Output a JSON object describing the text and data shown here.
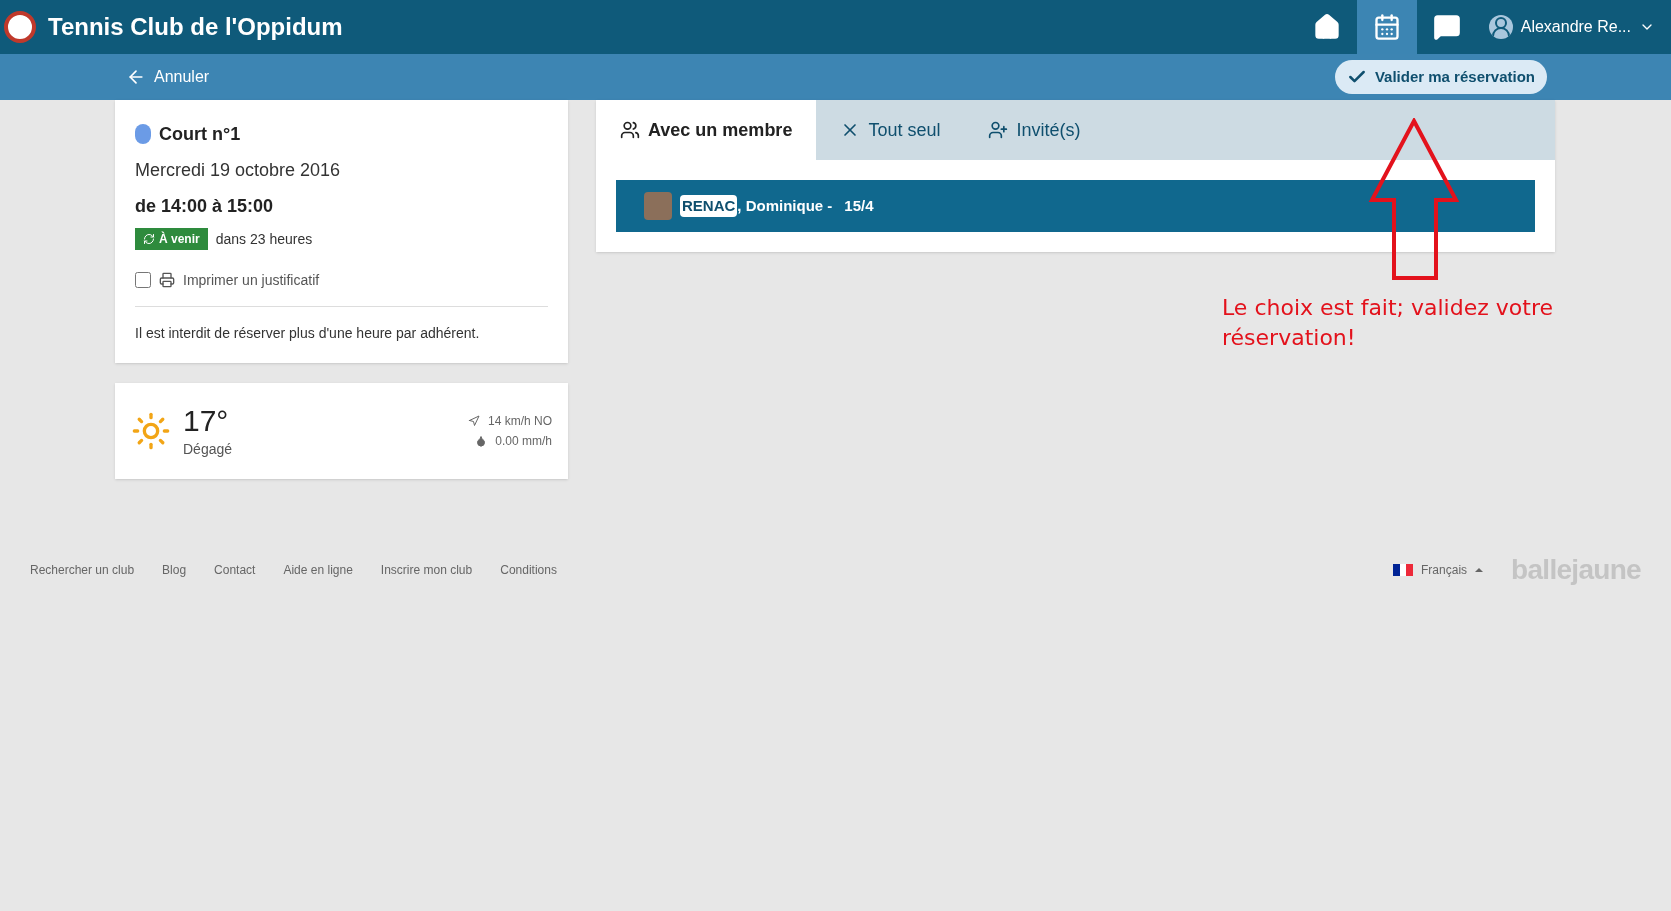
{
  "header": {
    "title": "Tennis Club de l'Oppidum",
    "nav": [
      {
        "kind": "home",
        "selected": false
      },
      {
        "kind": "calendar",
        "selected": true
      },
      {
        "kind": "chat",
        "selected": false
      }
    ],
    "user": "Alexandre Re..."
  },
  "toolbar": {
    "cancel": "Annuler",
    "validate": "Valider ma réservation"
  },
  "booking": {
    "court": {
      "name": "Court n°1",
      "color": "#6b9be6"
    },
    "date": "Mercredi 19 octobre 2016",
    "time": "de 14:00 à 15:00",
    "badge": "À venir",
    "countdown": "dans 23 heures",
    "print": {
      "label": "Imprimer un justificatif",
      "checked": false
    },
    "rule": "Il est interdit de réserver plus d'une heure par adhérent."
  },
  "weather": {
    "temperature": "17°",
    "condition": "Dégagé",
    "wind": "14 km/h NO",
    "rain": "0.00 mm/h"
  },
  "tabs": [
    {
      "kind": "member",
      "label": "Avec un membre",
      "selected": true
    },
    {
      "kind": "alone",
      "label": "Tout seul",
      "selected": false
    },
    {
      "kind": "guest",
      "label": "Invité(s)",
      "selected": false
    }
  ],
  "partner": {
    "last_name": "RENAC",
    "rest": ", Dominique -",
    "rank": "15/4"
  },
  "annotation": {
    "text": "Le choix est fait; validez votre réservation!"
  },
  "footer": {
    "links": [
      "Rechercher un club",
      "Blog",
      "Contact",
      "Aide en ligne",
      "Inscrire mon club",
      "Conditions"
    ],
    "language": "Français",
    "logo": "ballejaune"
  }
}
